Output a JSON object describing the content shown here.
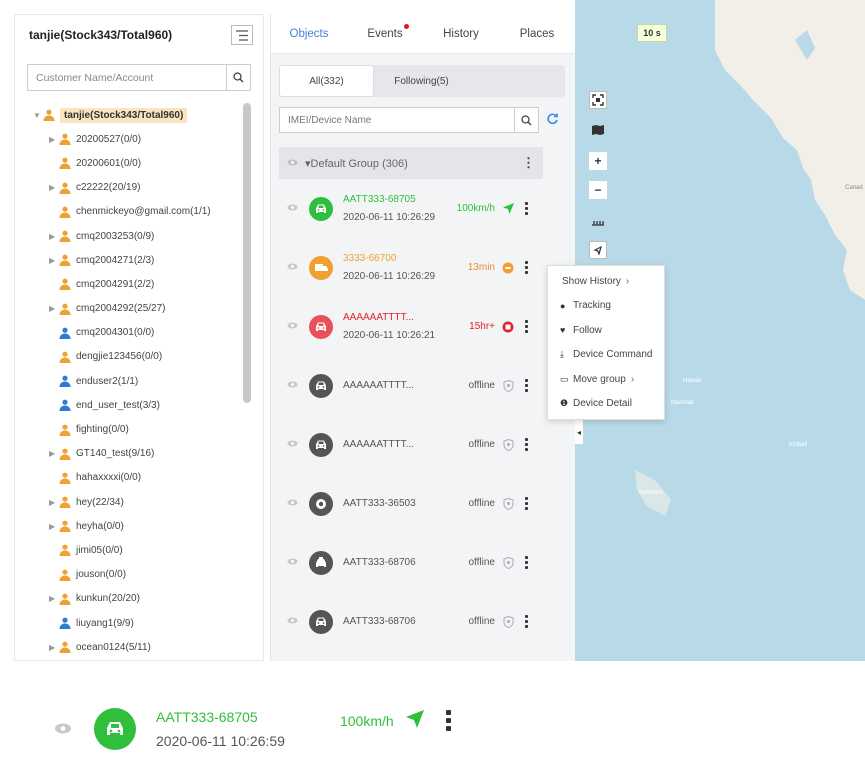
{
  "colors": {
    "accent": "#4a7fd4",
    "online": "#2fbf3c",
    "idle": "#f0a030",
    "alarm": "#e8505b",
    "offline": "#555555"
  },
  "left": {
    "title": "tanjie(Stock343/Total960)",
    "search_placeholder": "Customer Name/Account",
    "tree": [
      {
        "label": "tanjie(Stock343/Total960)",
        "root": true,
        "arrow": "down",
        "color": "orange"
      },
      {
        "label": "20200527(0/0)",
        "arrow": "right",
        "color": "orange"
      },
      {
        "label": "20200601(0/0)",
        "arrow": "",
        "color": "orange"
      },
      {
        "label": "c22222(20/19)",
        "arrow": "right",
        "color": "orange"
      },
      {
        "label": "chenmickeyo@gmail.com(1/1)",
        "arrow": "",
        "color": "orange"
      },
      {
        "label": "cmq2003253(0/9)",
        "arrow": "right",
        "color": "orange"
      },
      {
        "label": "cmq2004271(2/3)",
        "arrow": "right",
        "color": "orange"
      },
      {
        "label": "cmq2004291(2/2)",
        "arrow": "",
        "color": "orange"
      },
      {
        "label": "cmq2004292(25/27)",
        "arrow": "right",
        "color": "orange"
      },
      {
        "label": "cmq2004301(0/0)",
        "arrow": "",
        "color": "blue"
      },
      {
        "label": "dengjie123456(0/0)",
        "arrow": "",
        "color": "orange"
      },
      {
        "label": "enduser2(1/1)",
        "arrow": "",
        "color": "blue"
      },
      {
        "label": "end_user_test(3/3)",
        "arrow": "",
        "color": "blue"
      },
      {
        "label": "fighting(0/0)",
        "arrow": "",
        "color": "orange"
      },
      {
        "label": "GT140_test(9/16)",
        "arrow": "right",
        "color": "orange"
      },
      {
        "label": "hahaxxxxi(0/0)",
        "arrow": "",
        "color": "orange"
      },
      {
        "label": "hey(22/34)",
        "arrow": "right",
        "color": "orange"
      },
      {
        "label": "heyha(0/0)",
        "arrow": "right",
        "color": "orange"
      },
      {
        "label": "jimi05(0/0)",
        "arrow": "",
        "color": "orange"
      },
      {
        "label": "jouson(0/0)",
        "arrow": "",
        "color": "orange"
      },
      {
        "label": "kunkun(20/20)",
        "arrow": "right",
        "color": "orange"
      },
      {
        "label": "liuyang1(9/9)",
        "arrow": "",
        "color": "blue"
      },
      {
        "label": "ocean0124(5/11)",
        "arrow": "right",
        "color": "orange"
      }
    ]
  },
  "mid": {
    "tabs": [
      "Objects",
      "Events",
      "History",
      "Places"
    ],
    "subtabs": [
      "All(332)",
      "Following(5)"
    ],
    "search_placeholder": "IMEI/Device Name",
    "group_label": "Default Group (306)",
    "devices": [
      {
        "name": "AATT333-68705",
        "time": "2020-06-11 10:26:29",
        "status": "100km/h",
        "kind": "online",
        "shape": "car",
        "sicon": "arrow"
      },
      {
        "name": "3333-66700",
        "time": "2020-06-11 10:26:29",
        "status": "13min",
        "kind": "idle",
        "shape": "truck",
        "sicon": "idle"
      },
      {
        "name": "AAAAAATTTT...",
        "time": "2020-06-11 10:26:21",
        "status": "15hr+",
        "kind": "alarm",
        "shape": "car",
        "sicon": "alarm"
      },
      {
        "name": "AAAAAATTTT...",
        "time": "",
        "status": "offline",
        "kind": "offline",
        "shape": "car",
        "sicon": "shield"
      },
      {
        "name": "AAAAAATTTT...",
        "time": "",
        "status": "offline",
        "kind": "offline",
        "shape": "car",
        "sicon": "shield"
      },
      {
        "name": "AATT333-36503",
        "time": "",
        "status": "offline",
        "kind": "offline",
        "shape": "moto",
        "sicon": "shield"
      },
      {
        "name": "AATT333-68706",
        "time": "",
        "status": "offline",
        "kind": "offline",
        "shape": "taxi",
        "sicon": "shield"
      },
      {
        "name": "AATT333-68706",
        "time": "",
        "status": "offline",
        "kind": "offline",
        "shape": "car",
        "sicon": "shield"
      }
    ]
  },
  "map": {
    "timer": "10 s"
  },
  "menu": {
    "items": [
      {
        "label": "Show History",
        "icon": "",
        "chev": true
      },
      {
        "label": "Tracking",
        "icon": "pin"
      },
      {
        "label": "Follow",
        "icon": "heart"
      },
      {
        "label": "Device Command",
        "icon": "cmd"
      },
      {
        "label": "Move group",
        "icon": "folder",
        "chev": true
      },
      {
        "label": "Device Detail",
        "icon": "info"
      }
    ]
  },
  "zoom": {
    "name": "AATT333-68705",
    "time": "2020-06-11 10:26:59",
    "status": "100km/h"
  }
}
